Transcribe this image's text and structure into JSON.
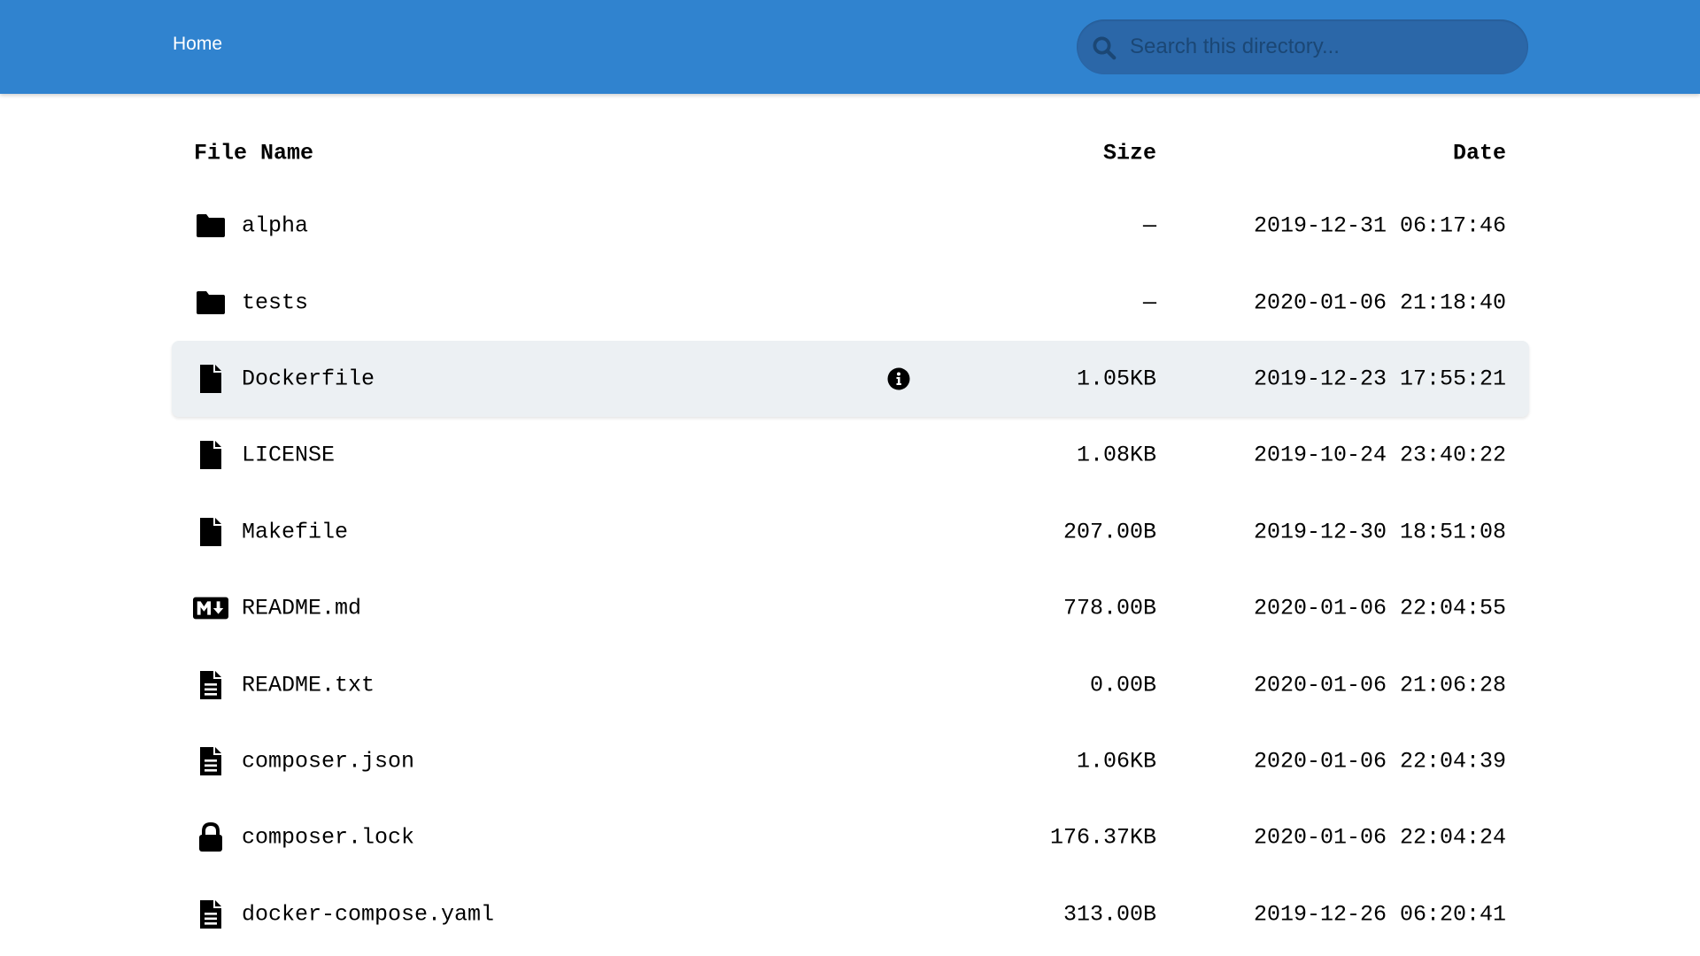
{
  "breadcrumb": {
    "home_label": "Home"
  },
  "search": {
    "placeholder": "Search this directory..."
  },
  "table": {
    "headers": {
      "name": "File Name",
      "size": "Size",
      "date": "Date"
    },
    "rows": [
      {
        "icon": "folder-icon",
        "name": "alpha",
        "size": "—",
        "date": "2019-12-31 06:17:46"
      },
      {
        "icon": "folder-icon",
        "name": "tests",
        "size": "—",
        "date": "2020-01-06 21:18:40"
      },
      {
        "icon": "file-icon",
        "name": "Dockerfile",
        "size": "1.05KB",
        "date": "2019-12-23 17:55:21"
      },
      {
        "icon": "file-icon",
        "name": "LICENSE",
        "size": "1.08KB",
        "date": "2019-10-24 23:40:22"
      },
      {
        "icon": "file-icon",
        "name": "Makefile",
        "size": "207.00B",
        "date": "2019-12-30 18:51:08"
      },
      {
        "icon": "markdown-icon",
        "name": "README.md",
        "size": "778.00B",
        "date": "2020-01-06 22:04:55"
      },
      {
        "icon": "file-text-icon",
        "name": "README.txt",
        "size": "0.00B",
        "date": "2020-01-06 21:06:28"
      },
      {
        "icon": "file-text-icon",
        "name": "composer.json",
        "size": "1.06KB",
        "date": "2020-01-06 22:04:39"
      },
      {
        "icon": "lock-icon",
        "name": "composer.lock",
        "size": "176.37KB",
        "date": "2020-01-06 22:04:24"
      },
      {
        "icon": "file-text-icon",
        "name": "docker-compose.yaml",
        "size": "313.00B",
        "date": "2019-12-26 06:20:41"
      }
    ]
  },
  "colors": {
    "topbar": "#3083cf",
    "search_bg": "#2b67a8",
    "row_highlight": "#ecf0f3"
  }
}
